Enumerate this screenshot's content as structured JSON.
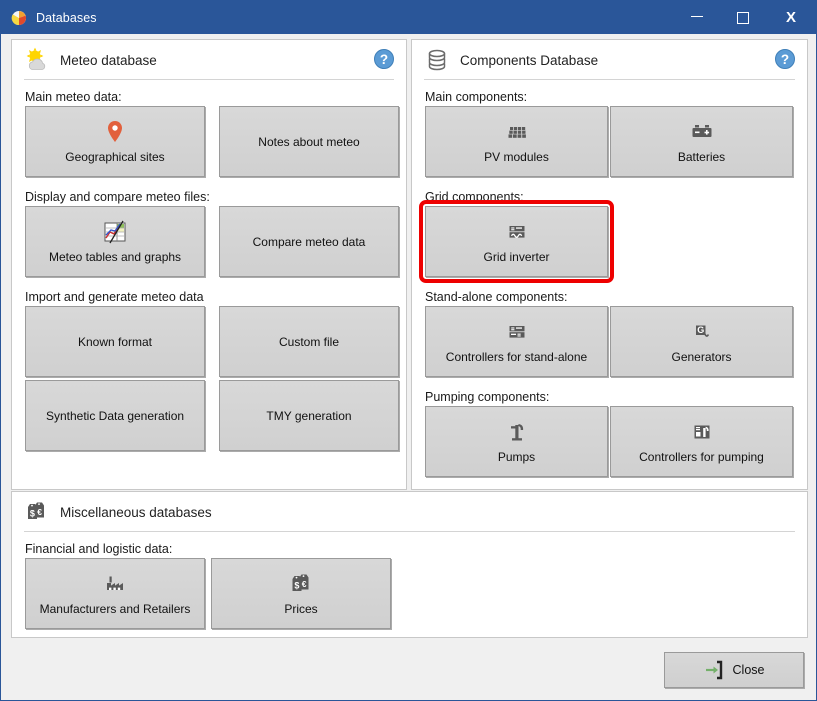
{
  "window": {
    "title": "Databases",
    "title_icon": "pvsyst-logo-icon",
    "buttons": {
      "minimize": "─",
      "maximize": "□",
      "close": "X"
    }
  },
  "panels": {
    "meteo": {
      "title": "Meteo database",
      "icon": "sun-cloud-icon",
      "help_label": "?",
      "groups": [
        {
          "label": "Main meteo data:",
          "buttons": [
            {
              "label": "Geographical sites",
              "icon": "map-pin-icon"
            },
            {
              "label": "Notes about meteo",
              "icon": "none"
            }
          ]
        },
        {
          "label": "Display and compare meteo files:",
          "buttons": [
            {
              "label": "Meteo tables and graphs",
              "icon": "chart-table-icon"
            },
            {
              "label": "Compare meteo data",
              "icon": "none"
            }
          ]
        },
        {
          "label": "Import and generate meteo data",
          "buttons": [
            {
              "label": "Known format",
              "icon": "none"
            },
            {
              "label": "Custom file",
              "icon": "none"
            },
            {
              "label": "Synthetic Data generation",
              "icon": "none"
            },
            {
              "label": "TMY generation",
              "icon": "none"
            }
          ]
        }
      ]
    },
    "components": {
      "title": "Components Database",
      "icon": "database-cylinder-icon",
      "help_label": "?",
      "groups": [
        {
          "label": "Main components:",
          "buttons": [
            {
              "label": "PV modules",
              "icon": "pv-module-icon"
            },
            {
              "label": "Batteries",
              "icon": "battery-icon"
            }
          ]
        },
        {
          "label": "Grid components:",
          "buttons": [
            {
              "label": "Grid inverter",
              "icon": "grid-inverter-icon",
              "highlighted": true
            }
          ]
        },
        {
          "label": "Stand-alone components:",
          "buttons": [
            {
              "label": "Controllers for stand-alone",
              "icon": "controller-icon"
            },
            {
              "label": "Generators",
              "icon": "generator-icon"
            }
          ]
        },
        {
          "label": "Pumping components:",
          "buttons": [
            {
              "label": "Pumps",
              "icon": "pump-icon"
            },
            {
              "label": "Controllers for pumping",
              "icon": "pump-controller-icon"
            }
          ]
        }
      ]
    },
    "misc": {
      "title": "Miscellaneous databases",
      "icon": "price-tags-icon",
      "groups": [
        {
          "label": "Financial and logistic data:",
          "buttons": [
            {
              "label": "Manufacturers and Retailers",
              "icon": "factory-icon"
            },
            {
              "label": "Prices",
              "icon": "price-tags-icon"
            }
          ]
        }
      ]
    }
  },
  "footer": {
    "close_label": "Close",
    "close_icon": "exit-arrow-icon"
  },
  "colors": {
    "titlebar": "#2a5699",
    "highlight": "#ee0000",
    "help_blue": "#5b9bd5",
    "button_face": "#d4d4d4"
  }
}
